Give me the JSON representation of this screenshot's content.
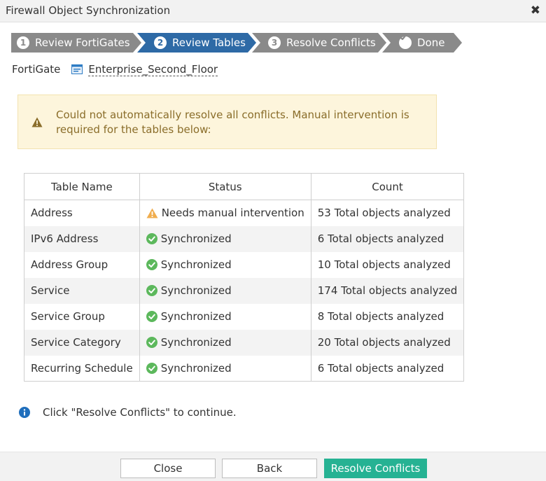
{
  "dialog": {
    "title": "Firewall Object Synchronization",
    "close_icon": "close-icon"
  },
  "wizard": {
    "steps": [
      {
        "number": "1",
        "label": "Review FortiGates",
        "state": "completed",
        "color": "#8a8a8a"
      },
      {
        "number": "2",
        "label": "Review Tables",
        "state": "active",
        "color": "#2e6aa6"
      },
      {
        "number": "3",
        "label": "Resolve Conflicts",
        "state": "pending",
        "color": "#8a8a8a"
      },
      {
        "number": "",
        "icon": "checkmark-icon",
        "label": "Done",
        "state": "pending",
        "color": "#8a8a8a"
      }
    ]
  },
  "fortigate": {
    "label": "FortiGate",
    "value": "Enterprise_Second_Floor",
    "icon": "device-icon"
  },
  "warning": {
    "icon": "warning-icon",
    "text": "Could not automatically resolve all conflicts. Manual intervention is required for the tables below:"
  },
  "table": {
    "headers": [
      "Table Name",
      "Status",
      "Count"
    ],
    "rows": [
      {
        "name": "Address",
        "status": "Needs manual intervention",
        "status_type": "warning",
        "count": "53 Total objects analyzed"
      },
      {
        "name": "IPv6 Address",
        "status": "Synchronized",
        "status_type": "success",
        "count": "6 Total objects analyzed"
      },
      {
        "name": "Address Group",
        "status": "Synchronized",
        "status_type": "success",
        "count": "10 Total objects analyzed"
      },
      {
        "name": "Service",
        "status": "Synchronized",
        "status_type": "success",
        "count": "174 Total objects analyzed"
      },
      {
        "name": "Service Group",
        "status": "Synchronized",
        "status_type": "success",
        "count": "8 Total objects analyzed"
      },
      {
        "name": "Service Category",
        "status": "Synchronized",
        "status_type": "success",
        "count": "20 Total objects analyzed"
      },
      {
        "name": "Recurring Schedule",
        "status": "Synchronized",
        "status_type": "success",
        "count": "6 Total objects analyzed"
      }
    ]
  },
  "info": {
    "icon": "info-icon",
    "text": "Click \"Resolve Conflicts\" to continue."
  },
  "footer": {
    "close_label": "Close",
    "back_label": "Back",
    "resolve_label": "Resolve Conflicts"
  },
  "colors": {
    "accent": "#2e6aa6",
    "step_inactive": "#8a8a8a",
    "primary_button": "#26b293",
    "success": "#5cb85c",
    "warning": "#f0ad4e",
    "info": "#1f6ebc",
    "warning_bg": "#fdf5dc",
    "warning_text": "#8a6d2a"
  }
}
